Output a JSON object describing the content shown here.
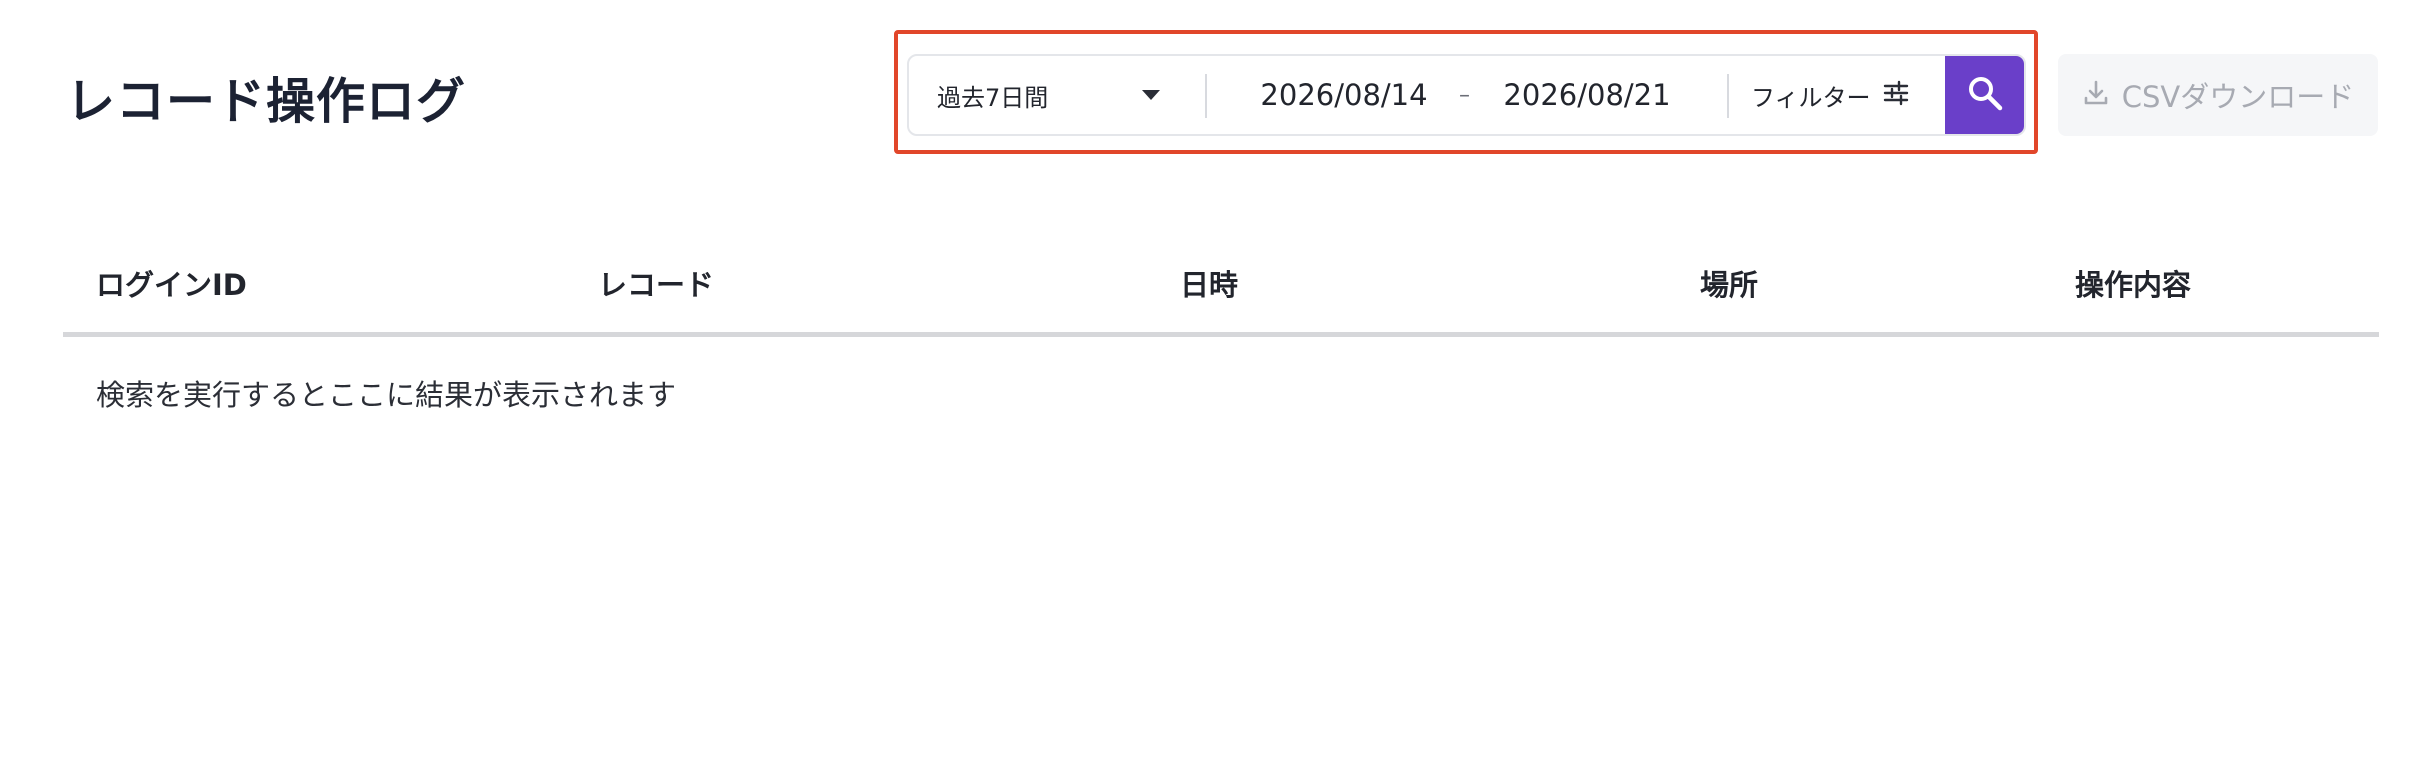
{
  "page": {
    "title": "レコード操作ログ"
  },
  "search": {
    "period_label": "過去7日間",
    "date_from": "2026/08/14",
    "date_separator": "–",
    "date_to": "2026/08/21",
    "filter_label": "フィルター",
    "search_icon": "search-icon",
    "accent_color": "#6a3fc9",
    "highlight_color": "#e1462a"
  },
  "export": {
    "csv_label": "CSVダウンロード",
    "icon": "download-icon",
    "disabled": true
  },
  "table": {
    "columns": [
      "ログインID",
      "レコード",
      "日時",
      "場所",
      "操作内容"
    ],
    "empty_message": "検索を実行するとここに結果が表示されます"
  }
}
